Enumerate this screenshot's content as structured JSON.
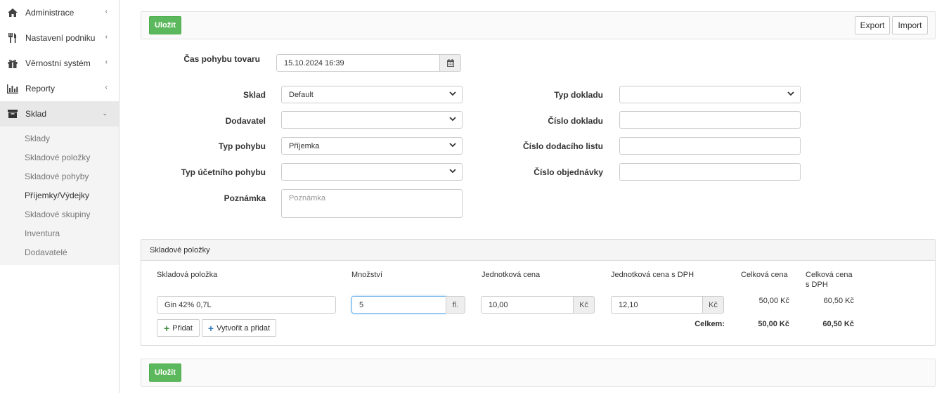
{
  "sidebar": {
    "items": [
      {
        "label": "Administrace",
        "icon": "home-icon"
      },
      {
        "label": "Nastavení podniku",
        "icon": "cutlery-icon"
      },
      {
        "label": "Věrnostní systém",
        "icon": "gift-icon"
      },
      {
        "label": "Reporty",
        "icon": "bar-chart-icon"
      },
      {
        "label": "Sklad",
        "icon": "archive-icon"
      }
    ],
    "subitems": [
      "Sklady",
      "Skladové položky",
      "Skladové pohyby",
      "Příjemky/Výdejky",
      "Skladové skupiny",
      "Inventura",
      "Dodavatelé"
    ]
  },
  "toolbar": {
    "save_label": "Uložit",
    "export_label": "Export",
    "import_label": "Import"
  },
  "form": {
    "time_label": "Čas pohybu tovaru",
    "time_value": "15.10.2024 16:39",
    "sklad_label": "Sklad",
    "sklad_value": "Default",
    "dodavatel_label": "Dodavatel",
    "dodavatel_value": "",
    "typ_pohybu_label": "Typ pohybu",
    "typ_pohybu_value": "Příjemka",
    "typ_ucetniho_label": "Typ účetního pohybu",
    "typ_ucetniho_value": "",
    "poznamka_label": "Poznámka",
    "poznamka_placeholder": "Poznámka",
    "typ_dokladu_label": "Typ dokladu",
    "typ_dokladu_value": "",
    "cislo_dokladu_label": "Číslo dokladu",
    "cislo_dokladu_value": "",
    "cislo_dodaciho_label": "Číslo dodacího listu",
    "cislo_dodaciho_value": "",
    "cislo_objednavky_label": "Číslo objednávky",
    "cislo_objednavky_value": ""
  },
  "items_panel": {
    "title": "Skladové položky",
    "headers": {
      "item": "Skladová položka",
      "qty": "Množství",
      "unit_price": "Jednotková cena",
      "unit_price_vat": "Jednotková cena s DPH",
      "total": "Celková cena",
      "total_vat_line1": "Celková cena",
      "total_vat_line2": "s DPH"
    },
    "row": {
      "item": "Gin 42% 0,7L",
      "qty": "5",
      "qty_unit": "fl.",
      "unit_price": "10,00",
      "unit_price_currency": "Kč",
      "unit_price_vat": "12,10",
      "unit_price_vat_currency": "Kč",
      "total": "50,00 Kč",
      "total_vat": "60,50 Kč"
    },
    "add_label": "Přidat",
    "create_add_label": "Vytvořit a přidat",
    "sum_label": "Celkem:",
    "sum_total": "50,00 Kč",
    "sum_total_vat": "60,50 Kč"
  },
  "colors": {
    "accent_green": "#5cb85c",
    "plus_green": "#3a8a3a",
    "plus_blue": "#337ab7"
  }
}
